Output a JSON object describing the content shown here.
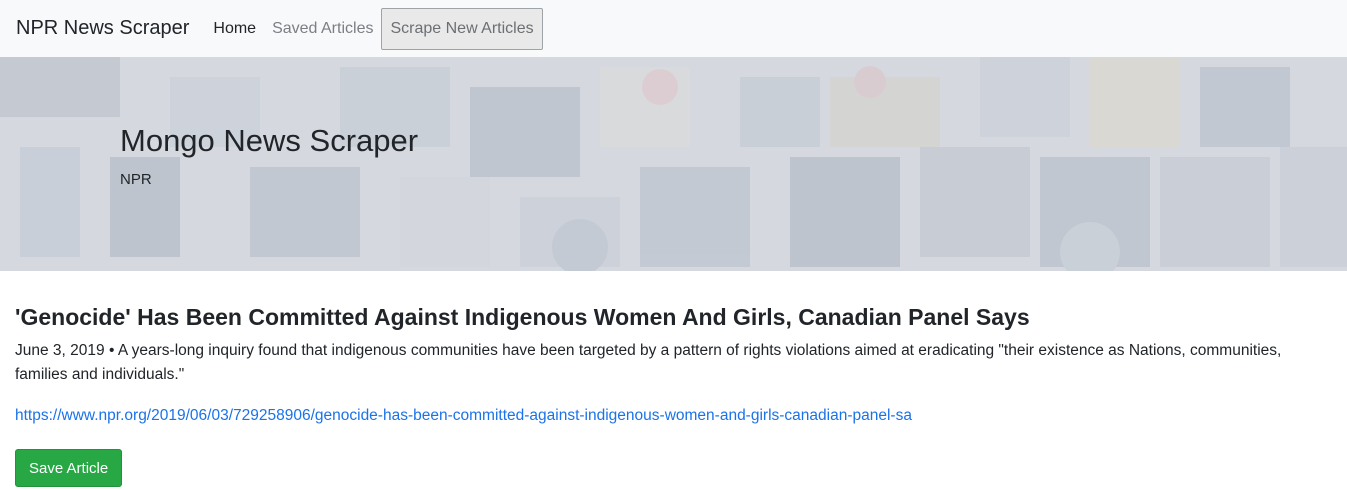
{
  "navbar": {
    "brand": "NPR News Scraper",
    "links": {
      "home": "Home",
      "saved": "Saved Articles"
    },
    "scrape_button": "Scrape New Articles"
  },
  "hero": {
    "title": "Mongo News Scraper",
    "subtitle": "NPR"
  },
  "article": {
    "title": "'Genocide' Has Been Committed Against Indigenous Women And Girls, Canadian Panel Says",
    "date": "June 3, 2019",
    "separator": "•",
    "summary": "A years-long inquiry found that indigenous communities have been targeted by a pattern of rights violations aimed at eradicating \"their existence as Nations, communities, families and individuals.\"",
    "url": "https://www.npr.org/2019/06/03/729258906/genocide-has-been-committed-against-indigenous-women-and-girls-canadian-panel-sa",
    "save_button": "Save Article"
  },
  "colors": {
    "navbar_bg": "#f8f9fa",
    "link": "#1a73e8",
    "save_button": "#28a745"
  }
}
